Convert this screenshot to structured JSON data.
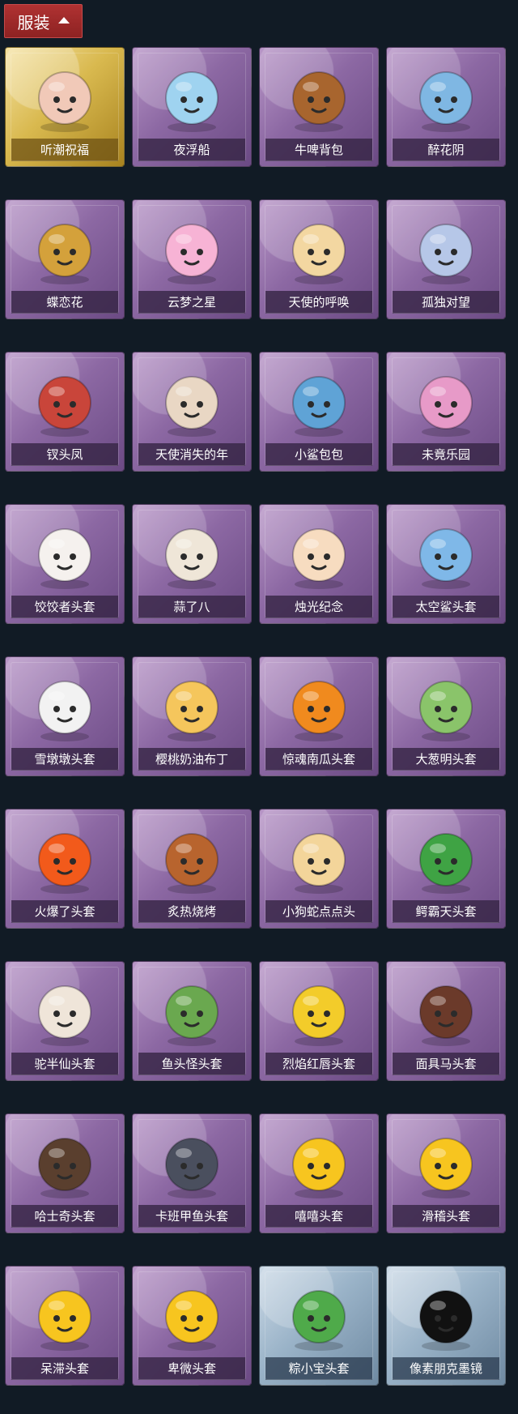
{
  "header": {
    "label": "服装",
    "icon": "chevron-up-icon"
  },
  "items": [
    {
      "label": "听潮祝福",
      "frame": "gold",
      "icon": "doll-figure-icon",
      "color": "#f1c9b8"
    },
    {
      "label": "夜浮船",
      "frame": "purple",
      "icon": "jellyfish-icon",
      "color": "#9fd3f0"
    },
    {
      "label": "牛啤背包",
      "frame": "purple",
      "icon": "beer-barrel-pig-icon",
      "color": "#a8652e"
    },
    {
      "label": "醉花阴",
      "frame": "purple",
      "icon": "dreamcatcher-icon",
      "color": "#7fb7e3"
    },
    {
      "label": "蝶恋花",
      "frame": "purple",
      "icon": "butterfly-bell-icon",
      "color": "#d4a13b"
    },
    {
      "label": "云梦之星",
      "frame": "purple",
      "icon": "unicorn-cloud-icon",
      "color": "#f7b3d5"
    },
    {
      "label": "天使的呼唤",
      "frame": "purple",
      "icon": "angel-doll-icon",
      "color": "#f3d7a1"
    },
    {
      "label": "孤独对望",
      "frame": "purple",
      "icon": "girl-charm-icon",
      "color": "#b6c7e8"
    },
    {
      "label": "钗头凤",
      "frame": "purple",
      "icon": "phoenix-crown-doll-icon",
      "color": "#c9453a"
    },
    {
      "label": "天使消失的年",
      "frame": "purple",
      "icon": "halo-girl-icon",
      "color": "#e9d7c4"
    },
    {
      "label": "小鲨包包",
      "frame": "purple",
      "icon": "shark-bag-icon",
      "color": "#5fa3d6"
    },
    {
      "label": "未竟乐园",
      "frame": "purple",
      "icon": "bunny-girl-icon",
      "color": "#e79ac8"
    },
    {
      "label": "饺饺者头套",
      "frame": "purple",
      "icon": "dumpling-head-icon",
      "color": "#f5f1ee"
    },
    {
      "label": "蒜了八",
      "frame": "purple",
      "icon": "garlic-head-icon",
      "color": "#efe6d8"
    },
    {
      "label": "烛光纪念",
      "frame": "purple",
      "icon": "candle-head-icon",
      "color": "#f7dcc0"
    },
    {
      "label": "太空鲨头套",
      "frame": "purple",
      "icon": "space-shark-head-icon",
      "color": "#7fb8e8"
    },
    {
      "label": "雪墩墩头套",
      "frame": "purple",
      "icon": "snowman-head-icon",
      "color": "#f2f2f2"
    },
    {
      "label": "樱桃奶油布丁",
      "frame": "purple",
      "icon": "pudding-head-icon",
      "color": "#f5c65c"
    },
    {
      "label": "惊魂南瓜头套",
      "frame": "purple",
      "icon": "pumpkin-head-icon",
      "color": "#f08a1e"
    },
    {
      "label": "大葱明头套",
      "frame": "purple",
      "icon": "bok-choy-head-icon",
      "color": "#8ac46a"
    },
    {
      "label": "火爆了头套",
      "frame": "purple",
      "icon": "fire-head-icon",
      "color": "#f25a1b"
    },
    {
      "label": "炙热烧烤",
      "frame": "purple",
      "icon": "bbq-meat-head-icon",
      "color": "#b8642e"
    },
    {
      "label": "小狗蛇点点头",
      "frame": "purple",
      "icon": "snake-head-icon",
      "color": "#f3d59a"
    },
    {
      "label": "鳄霸天头套",
      "frame": "purple",
      "icon": "crocodile-head-icon",
      "color": "#3fa344"
    },
    {
      "label": "驼半仙头套",
      "frame": "purple",
      "icon": "bear-glasses-head-icon",
      "color": "#efe5d9"
    },
    {
      "label": "鱼头怪头套",
      "frame": "purple",
      "icon": "fish-mask-icon",
      "color": "#6aa84f"
    },
    {
      "label": "烈焰红唇头套",
      "frame": "purple",
      "icon": "pikachu-mask-icon",
      "color": "#f3cc2a"
    },
    {
      "label": "面具马头套",
      "frame": "purple",
      "icon": "horse-mask-icon",
      "color": "#6b3a2a"
    },
    {
      "label": "哈士奇头套",
      "frame": "purple",
      "icon": "husky-head-icon",
      "color": "#5a3f2e"
    },
    {
      "label": "卡班甲鱼头套",
      "frame": "purple",
      "icon": "fish-head-icon",
      "color": "#4a4f5e"
    },
    {
      "label": "嘻嘻头套",
      "frame": "purple",
      "icon": "grin-emoji-head-icon",
      "color": "#f7c51f"
    },
    {
      "label": "滑稽头套",
      "frame": "purple",
      "icon": "smirk-emoji-head-icon",
      "color": "#f7c51f"
    },
    {
      "label": "呆滞头套",
      "frame": "purple",
      "icon": "dazed-emoji-head-icon",
      "color": "#f7c51f"
    },
    {
      "label": "卑微头套",
      "frame": "purple",
      "icon": "humble-emoji-head-icon",
      "color": "#f7c51f"
    },
    {
      "label": "粽小宝头套",
      "frame": "blue",
      "icon": "zongzi-head-icon",
      "color": "#4faa4a"
    },
    {
      "label": "像素朋克墨镜",
      "frame": "blue",
      "icon": "pixel-sunglasses-icon",
      "color": "#111111"
    }
  ]
}
